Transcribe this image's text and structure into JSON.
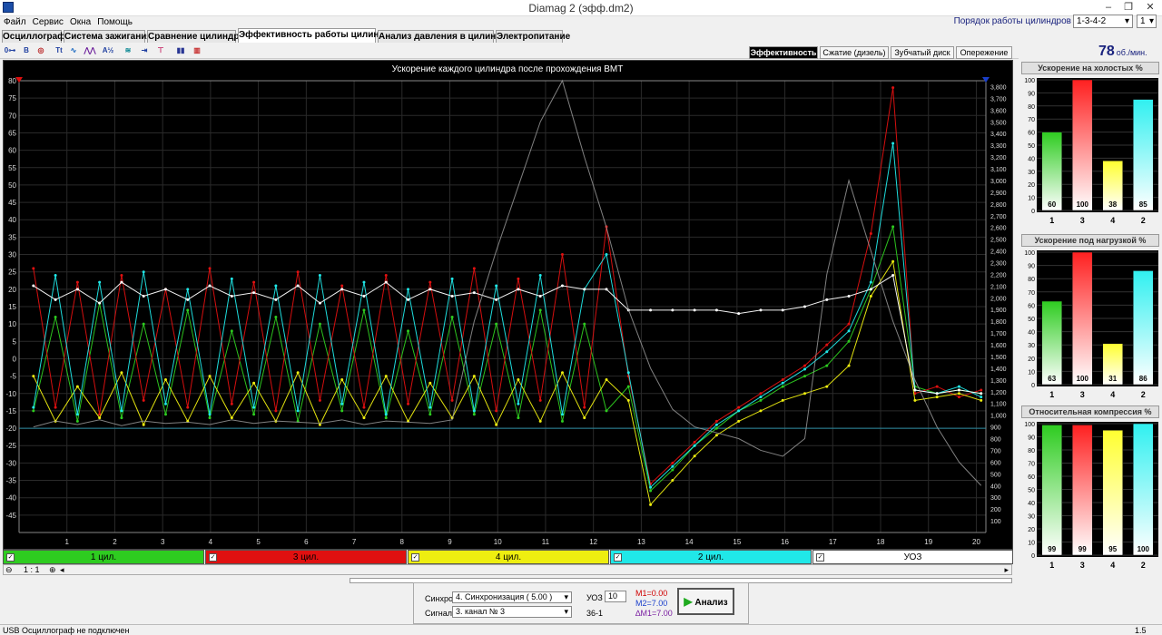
{
  "window": {
    "title": "Diamag 2 (эфф.dm2)"
  },
  "menu": [
    "Файл",
    "Сервис",
    "Окна",
    "Помощь"
  ],
  "cylinder_order": {
    "label": "Порядок работы цилиндров",
    "value": "1-3-4-2",
    "spin": "1"
  },
  "tabs": [
    "Осциллограф",
    "Система зажигания",
    "Сравнение цилиндров",
    "Эффективность работы цилиндров",
    "Анализ давления в цилиндре",
    "Электропитание"
  ],
  "subtabs": [
    "Эффективность",
    "Сжатие (дизель)",
    "Зубчатый диск",
    "Опережение"
  ],
  "rpm": {
    "value": "78",
    "unit": "об./мин."
  },
  "plot_title": "Ускорение каждого цилиндра после прохождения ВМТ",
  "channels": [
    {
      "label": "1 цил.",
      "color": "#2ecc20"
    },
    {
      "label": "3 цил.",
      "color": "#e01010"
    },
    {
      "label": "4 цил.",
      "color": "#eeee10"
    },
    {
      "label": "2 цил.",
      "color": "#20e8e8"
    },
    {
      "label": "УОЗ",
      "color": "#ffffff"
    }
  ],
  "zoom": "1 : 1",
  "bottom": {
    "sync_label": "Синхро:",
    "sync_value": "4. Синхронизация ( 5.00 )",
    "signal_label": "Сигнал:",
    "signal_value": "3. канал № 3",
    "uoz_label": "УОЗ",
    "uoz_value": "10",
    "teeth": "36-1",
    "m1": "M1=0.00",
    "m2": "M2=7.00",
    "dm": "∆M1=7.00",
    "analyze": "Анализ"
  },
  "status": {
    "left": "USB Осциллограф не подключен",
    "right": "1.5"
  },
  "chart_data": [
    {
      "type": "line",
      "title": "Ускорение каждого цилиндра после прохождения ВМТ",
      "x": {
        "ticks": [
          1,
          2,
          3,
          4,
          5,
          6,
          7,
          8,
          9,
          10,
          11,
          12,
          13,
          14,
          15,
          16,
          17,
          18,
          19,
          20
        ],
        "range": [
          0,
          20.2
        ]
      },
      "y_left": {
        "range": [
          -50,
          80
        ],
        "ticks": [
          80,
          75,
          70,
          65,
          60,
          55,
          50,
          45,
          40,
          35,
          30,
          25,
          20,
          15,
          10,
          5,
          0,
          -5,
          -10,
          -15,
          -20,
          -25,
          -30,
          -35,
          -40,
          -45
        ]
      },
      "y_right": {
        "range": [
          0,
          3850
        ],
        "ticks": [
          3800,
          3700,
          3600,
          3500,
          3400,
          3300,
          3200,
          3100,
          3000,
          2900,
          2800,
          2700,
          2600,
          2500,
          2400,
          2300,
          2200,
          2100,
          2000,
          1900,
          1800,
          1700,
          1600,
          1500,
          1400,
          1300,
          1200,
          1100,
          1000,
          900,
          800,
          700,
          600,
          500,
          400,
          300,
          200,
          100
        ]
      },
      "reference_line_y": -20,
      "grid": true,
      "series": [
        {
          "name": "1 цил.",
          "color": "#2ecc20",
          "values": [
            -15,
            12,
            -18,
            16,
            -17,
            10,
            -16,
            14,
            -17,
            8,
            -16,
            12,
            -18,
            10,
            -15,
            14,
            -17,
            8,
            -16,
            12,
            -16,
            10,
            -17,
            14,
            -18,
            10,
            -15,
            -8,
            -38,
            -32,
            -25,
            -20,
            -15,
            -12,
            -8,
            -5,
            -2,
            5,
            20,
            38,
            -8,
            -10,
            -9,
            -10
          ]
        },
        {
          "name": "3 цил.",
          "color": "#e01010",
          "values": [
            26,
            -14,
            22,
            -16,
            24,
            -12,
            20,
            -14,
            26,
            -13,
            22,
            -15,
            25,
            -12,
            21,
            -14,
            24,
            -13,
            22,
            -12,
            26,
            -15,
            23,
            -12,
            30,
            -14,
            38,
            -5,
            -36,
            -30,
            -24,
            -18,
            -14,
            -10,
            -6,
            -2,
            4,
            10,
            36,
            78,
            -10,
            -8,
            -11,
            -9
          ]
        },
        {
          "name": "4 цил.",
          "color": "#eeee10",
          "values": [
            -5,
            -18,
            -8,
            -17,
            -4,
            -19,
            -6,
            -18,
            -5,
            -17,
            -7,
            -18,
            -4,
            -19,
            -6,
            -17,
            -5,
            -18,
            -7,
            -17,
            -5,
            -19,
            -6,
            -18,
            -4,
            -17,
            -6,
            -12,
            -42,
            -35,
            -28,
            -22,
            -18,
            -15,
            -12,
            -10,
            -8,
            -2,
            18,
            28,
            -12,
            -11,
            -10,
            -12
          ]
        },
        {
          "name": "2 цил.",
          "color": "#20e8e8",
          "values": [
            -14,
            24,
            -16,
            22,
            -15,
            25,
            -13,
            20,
            -16,
            23,
            -14,
            21,
            -15,
            24,
            -13,
            22,
            -16,
            20,
            -14,
            23,
            -15,
            21,
            -13,
            24,
            -16,
            20,
            30,
            -4,
            -37,
            -31,
            -25,
            -19,
            -15,
            -11,
            -7,
            -3,
            2,
            8,
            22,
            62,
            -9,
            -10,
            -8,
            -11
          ]
        },
        {
          "name": "УОЗ",
          "color": "#ffffff",
          "values": [
            21,
            17,
            20,
            16,
            22,
            18,
            20,
            17,
            21,
            18,
            19,
            17,
            21,
            16,
            20,
            18,
            22,
            17,
            20,
            18,
            19,
            17,
            20,
            18,
            21,
            20,
            20,
            14,
            14,
            14,
            14,
            14,
            13,
            14,
            14,
            15,
            17,
            18,
            20,
            24,
            -9,
            -10,
            -9,
            -10
          ]
        },
        {
          "name": "",
          "color": "#a0a0a0",
          "axis": "right",
          "values": [
            900,
            950,
            920,
            960,
            910,
            950,
            930,
            940,
            920,
            960,
            930,
            950,
            940,
            930,
            960,
            920,
            950,
            940,
            930,
            960,
            1800,
            2400,
            2950,
            3500,
            3850,
            3200,
            2600,
            1900,
            1400,
            1050,
            900,
            850,
            800,
            700,
            650,
            800,
            2200,
            3000,
            2400,
            1800,
            1300,
            900,
            600,
            400
          ]
        }
      ]
    },
    {
      "type": "bar",
      "title": "Ускорение на холостых %",
      "categories": [
        "1",
        "3",
        "4",
        "2"
      ],
      "values": [
        60,
        100,
        38,
        85
      ],
      "ylim": [
        0,
        100
      ],
      "colors": [
        "#2ecc20",
        "#ff2020",
        "#ffff30",
        "#30f0f0"
      ]
    },
    {
      "type": "bar",
      "title": "Ускорение под нагрузкой %",
      "categories": [
        "1",
        "3",
        "4",
        "2"
      ],
      "values": [
        63,
        100,
        31,
        86
      ],
      "ylim": [
        0,
        100
      ],
      "colors": [
        "#2ecc20",
        "#ff2020",
        "#ffff30",
        "#30f0f0"
      ]
    },
    {
      "type": "bar",
      "title": "Относительная компрессия %",
      "categories": [
        "1",
        "3",
        "4",
        "2"
      ],
      "values": [
        99,
        99,
        95,
        100
      ],
      "ylim": [
        0,
        100
      ],
      "colors": [
        "#2ecc20",
        "#ff2020",
        "#ffff30",
        "#30f0f0"
      ]
    }
  ]
}
